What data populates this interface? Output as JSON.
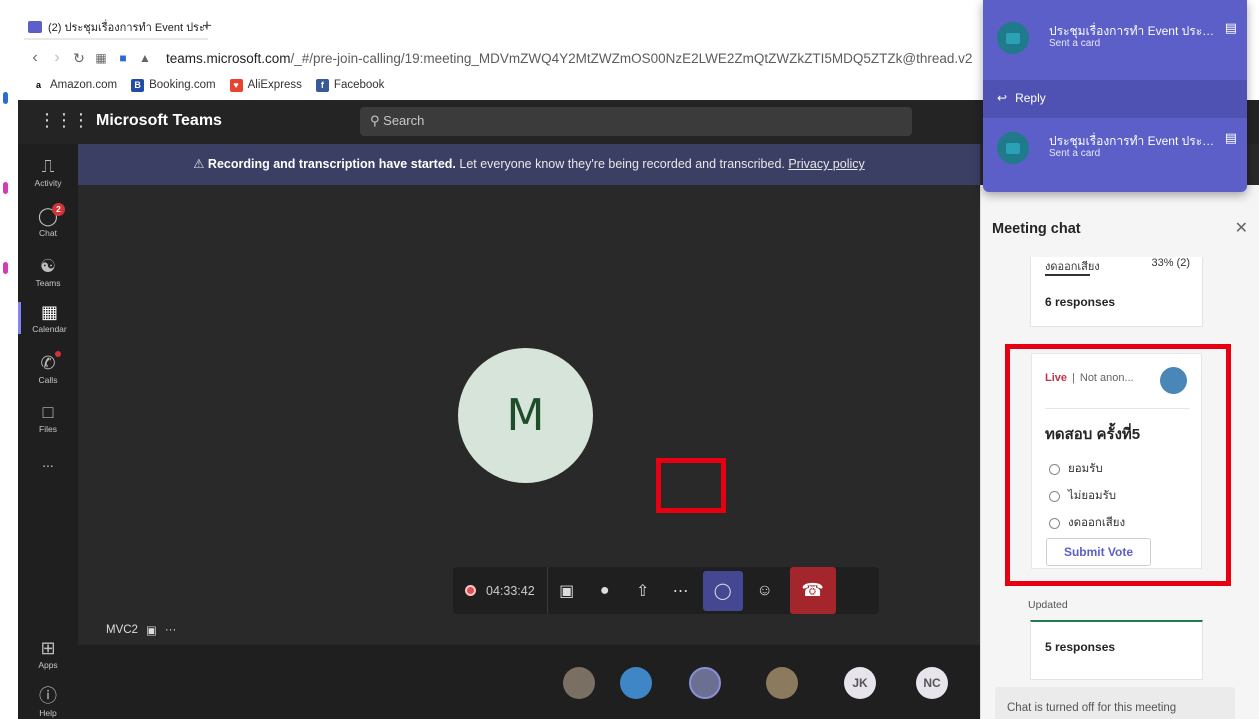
{
  "browser": {
    "tab_title": "(2) ประชุมเรื่องการทำ Event ประชุ...",
    "new_tab": "+",
    "url_domain": "teams.microsoft.com",
    "url_path": "/_#/pre-join-calling/19:meeting_MDVmZWQ4Y2MtZWZmOS00NzE2LWE2ZmQtZWZkZTI5MDQ5ZTZk@thread.v2",
    "bookmarks": [
      "Amazon.com",
      "Booking.com",
      "AliExpress",
      "Facebook"
    ]
  },
  "teams": {
    "app_title": "Microsoft Teams",
    "search_placeholder": "Search",
    "rail": {
      "activity": "Activity",
      "chat": "Chat",
      "chat_badge": "2",
      "teams": "Teams",
      "calendar": "Calendar",
      "calls": "Calls",
      "files": "Files",
      "more": "...",
      "apps": "Apps",
      "help": "Help"
    },
    "banner": {
      "bold": "Recording and transcription have started.",
      "text": " Let everyone know they're being recorded and transcribed. ",
      "link": "Privacy policy"
    },
    "stage": {
      "avatar_initial": "M",
      "timer": "04:33:42",
      "self_name": "MVC2",
      "self_more": "···"
    },
    "participants": [
      "JK",
      "NC"
    ]
  },
  "chat": {
    "title": "Meeting chat",
    "prev_card": {
      "option": "งดออกเสียง",
      "percent": "33% (2)",
      "responses": "6 responses"
    },
    "poll": {
      "status": "Live",
      "separator": "|",
      "anon": "Not anon...",
      "question": "ทดสอบ ครั้งที่5",
      "options": [
        "ยอมรับ",
        "ไม่ยอมรับ",
        "งดออกเสียง"
      ],
      "submit": "Submit Vote"
    },
    "updated": "Updated",
    "next_card": {
      "responses": "5 responses"
    },
    "chat_off": "Chat is turned off for this meeting"
  },
  "notifications": [
    {
      "title": "ประชุมเรื่องการทำ Event ประชุ...",
      "subtitle": "Sent a card"
    },
    {
      "title": "ประชุมเรื่องการทำ Event ประชุ...",
      "subtitle": "Sent a card"
    }
  ],
  "notification_reply": "Reply",
  "colors": {
    "teams_purple": "#5b5fc7",
    "banner": "#3b3f64",
    "hangup": "#a4262c",
    "highlight": "#e60012",
    "live": "#c4314b"
  }
}
